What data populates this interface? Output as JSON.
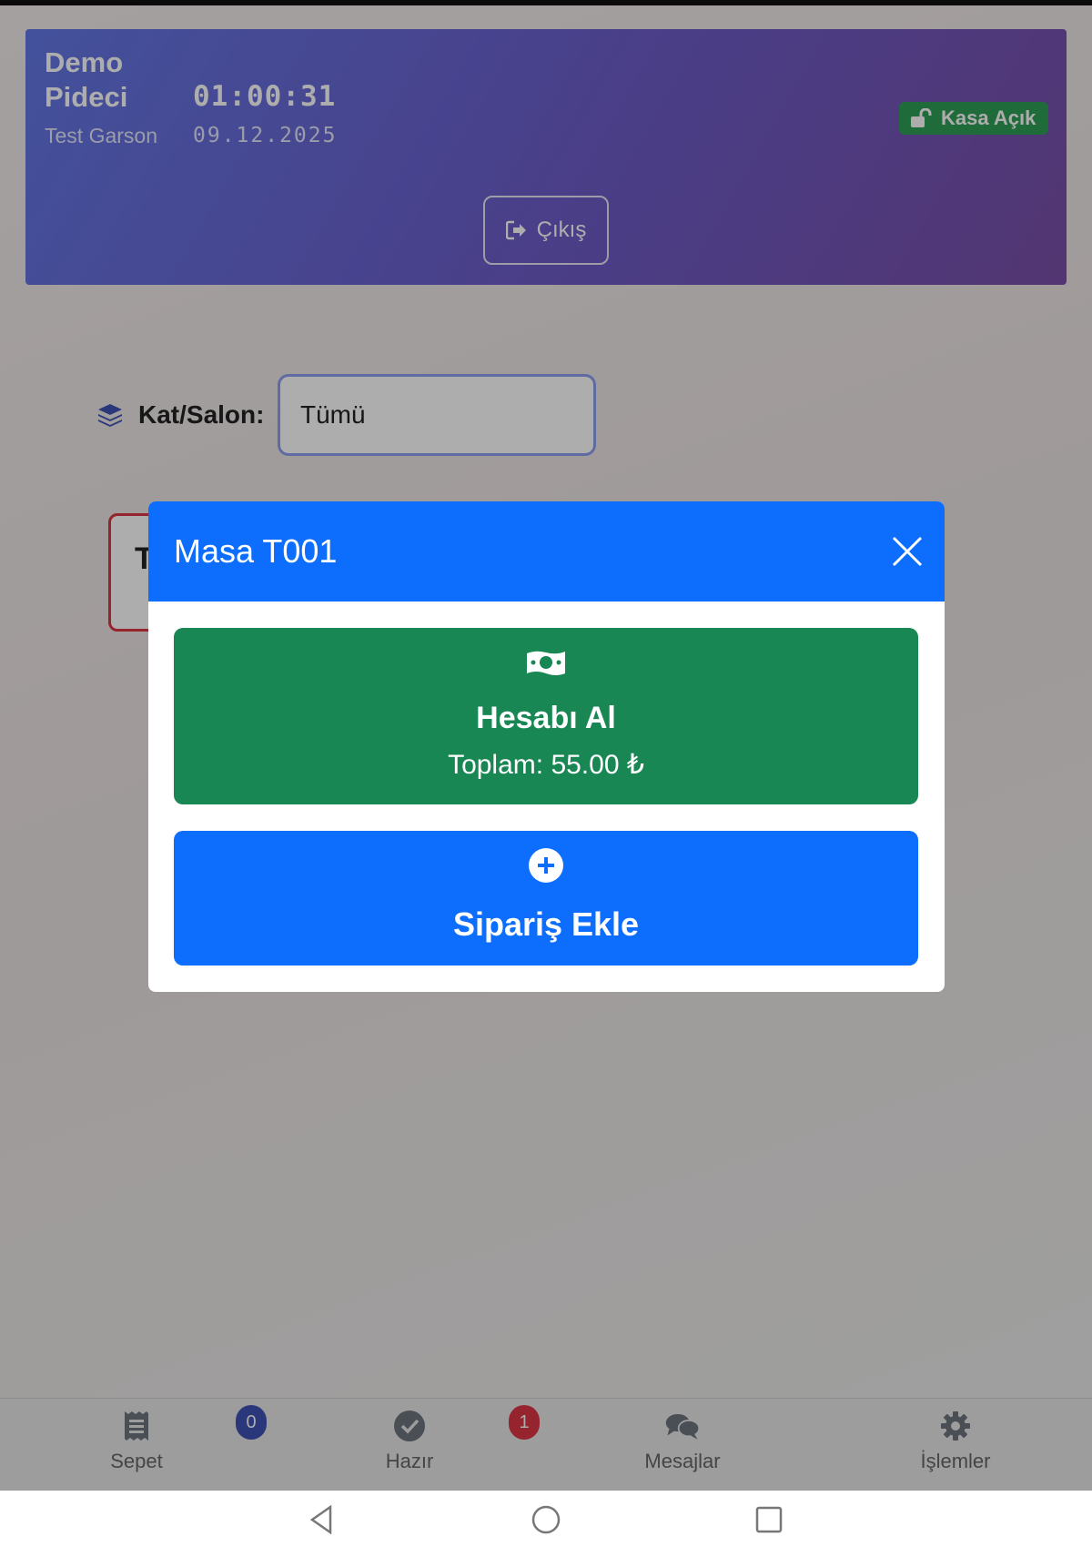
{
  "header": {
    "restaurant_name": "Demo Pideci",
    "user_name": "Test Garson",
    "clock": "01:00:31",
    "date": "09.12.2025",
    "cash_status": "Kasa Açık",
    "logout_label": "Çıkış"
  },
  "filter": {
    "label": "Kat/Salon:",
    "selected": "Tümü"
  },
  "table_card": {
    "label_visible": "T"
  },
  "modal": {
    "title": "Masa T001",
    "pay": {
      "label": "Hesabı Al",
      "total": "Toplam: 55.00 ₺"
    },
    "add_order": {
      "label": "Sipariş Ekle"
    }
  },
  "bottom_nav": {
    "items": [
      {
        "label": "Sepet",
        "icon": "receipt-icon"
      },
      {
        "label": "Hazır",
        "icon": "check-circle-icon"
      },
      {
        "label": "Mesajlar",
        "icon": "chat-bubbles-icon"
      },
      {
        "label": "İşlemler",
        "icon": "gear-icon"
      }
    ],
    "badges": {
      "sepet": "0",
      "hazir": "1"
    }
  },
  "colors": {
    "header_start": "#6478e6",
    "header_end": "#7a4fa8",
    "primary": "#0d6efd",
    "success": "#198754",
    "badge_blue": "#3f51b5",
    "badge_red": "#dc3545"
  }
}
